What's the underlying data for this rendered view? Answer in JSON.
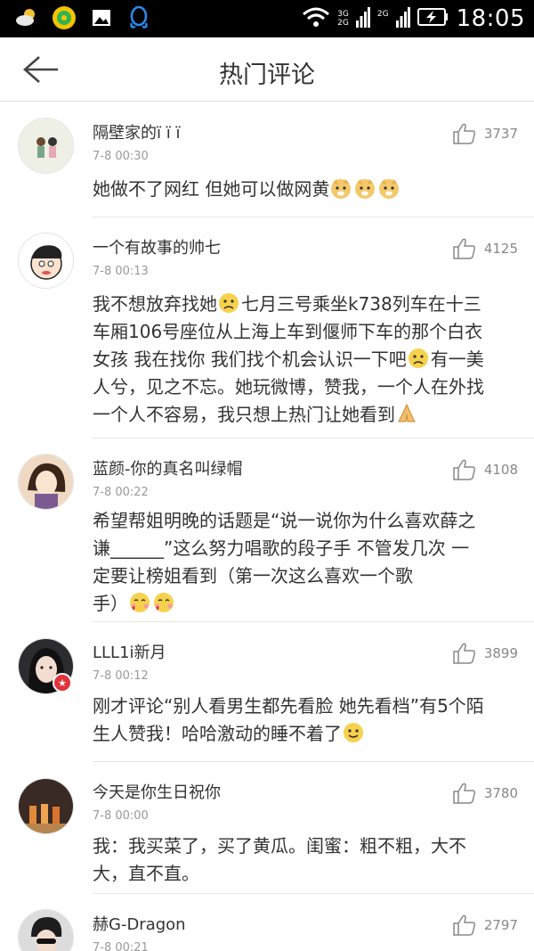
{
  "status_bar": {
    "net_top": "3G",
    "net_bottom": "2G",
    "net_second": "2G",
    "time": "18:05"
  },
  "header": {
    "title": "热门评论",
    "back_icon": "arrow-left-icon"
  },
  "comments": [
    {
      "user": "隔壁家的ï ï ï",
      "time": "7-8 00:30",
      "likes": "3737",
      "text": "她做不了网红 但她可以做网黄"
    },
    {
      "user": "一个有故事的帅七",
      "time": "7-8 00:13",
      "likes": "4125",
      "text_l1a": "我不想放弃找她",
      "text_l1b": "七月三号乘坐k738列车在十三",
      "text_l2": "车厢106号座位从上海上车到偃师下车的那个白衣",
      "text_l3a": "女孩 我在找你 我们找个机会认识一下吧",
      "text_l3b": "有一美",
      "text_l4": "人兮，见之不忘。她玩微博，赞我，一个人在外找",
      "text_l5": "一个人不容易，我只想上热门让她看到"
    },
    {
      "user": "蓝颜-你的真名叫绿帽",
      "time": "7-8 00:22",
      "likes": "4108",
      "text_l1": "希望帮姐明晚的话题是“说一说你为什么喜欢薛之",
      "text_l2": "谦______”这么努力唱歌的段子手 不管发几次 一",
      "text_l3": "定要让榜姐看到（第一次这么喜欢一个歌",
      "text_l4": "手）"
    },
    {
      "user": "LLL1i新月",
      "time": "7-8 00:12",
      "likes": "3899",
      "text_l1": "刚才评论“别人看男生都先看脸 她先看档”有5个陌",
      "text_l2": "生人赞我！哈哈激动的睡不着了"
    },
    {
      "user": "今天是你生日祝你",
      "time": "7-8 00:00",
      "likes": "3780",
      "text_l1": "我：我买菜了，买了黄瓜。闺蜜：粗不粗，大不",
      "text_l2": "大，直不直。"
    },
    {
      "user": "赫G-Dragon",
      "time": "7-8 00:21",
      "likes": "2797"
    }
  ],
  "colors": {
    "status_bg": "#000000",
    "divider": "#e6e6e6",
    "meta": "#999999",
    "text": "#333333",
    "badge": "#e2333b"
  }
}
